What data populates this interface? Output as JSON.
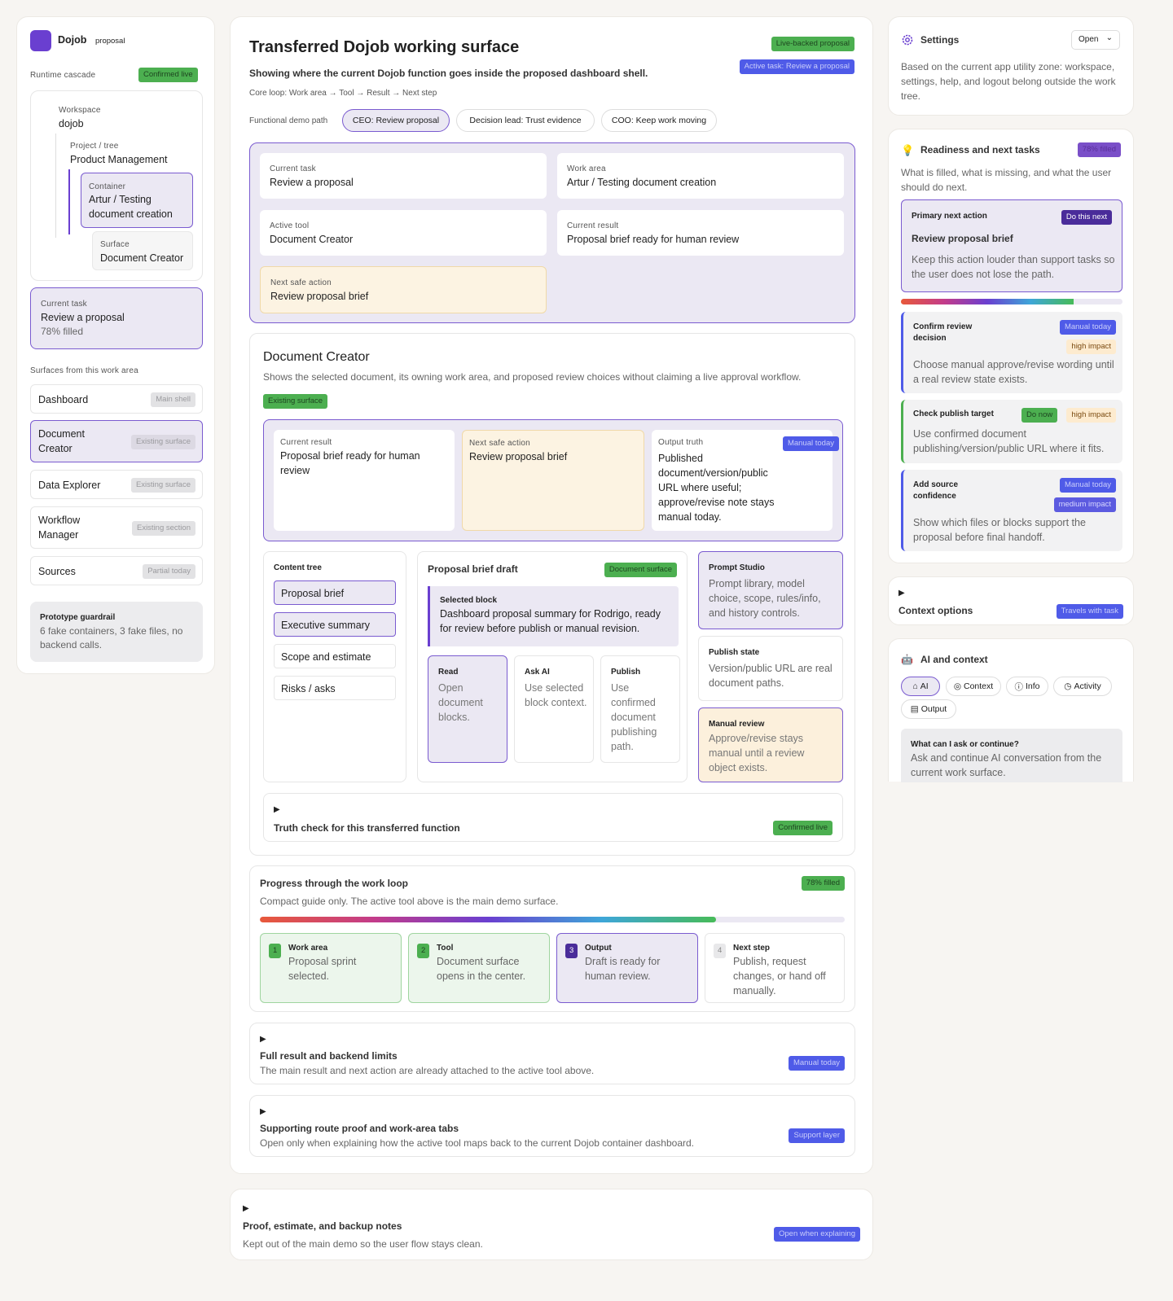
{
  "app": {
    "name": "Dojob",
    "tag": "proposal"
  },
  "left": {
    "cascade_label": "Runtime cascade",
    "cascade_badge": "Confirmed live",
    "workspace_label": "Workspace",
    "workspace_value": "dojob",
    "project_label": "Project / tree",
    "project_value": "Product Management",
    "container_label": "Container",
    "container_value": "Artur / Testing document creation",
    "surface_label": "Surface",
    "surface_value": "Document Creator",
    "task_label": "Current task",
    "task_value": "Review a proposal",
    "task_fill": "78% filled",
    "surfaces_heading": "Surfaces from this work area",
    "surfaces": [
      {
        "name": "Dashboard",
        "badge": "Main shell"
      },
      {
        "name": "Document Creator",
        "badge": "Existing surface"
      },
      {
        "name": "Data Explorer",
        "badge": "Existing surface"
      },
      {
        "name": "Workflow Manager",
        "badge": "Existing section"
      },
      {
        "name": "Sources",
        "badge": "Partial today"
      }
    ],
    "guardrail_title": "Prototype guardrail",
    "guardrail_text": "6 fake containers, 3 fake files, no backend calls."
  },
  "main": {
    "title": "Transferred Dojob working surface",
    "badge_live": "Live-backed proposal",
    "badge_task": "Active task: Review a proposal",
    "subtitle": "Showing where the current Dojob function goes inside the proposed dashboard shell.",
    "core_loop": "Core loop: Work area → Tool → Result → Next step",
    "demo_path_label": "Functional demo path",
    "demo_paths": [
      "CEO: Review proposal",
      "Decision lead: Trust evidence",
      "COO: Keep work moving"
    ],
    "summary": {
      "task_label": "Current task",
      "task_value": "Review a proposal",
      "area_label": "Work area",
      "area_value": "Artur / Testing document creation",
      "tool_label": "Active tool",
      "tool_value": "Document Creator",
      "result_label": "Current result",
      "result_value": "Proposal brief ready for human review",
      "next_label": "Next safe action",
      "next_value": "Review proposal brief"
    },
    "doc": {
      "title": "Document Creator",
      "desc": "Shows the selected document, its owning work area, and proposed review choices without claiming a live approval workflow.",
      "badge": "Existing surface",
      "result_label": "Current result",
      "result_value": "Proposal brief ready for human review",
      "next_label": "Next safe action",
      "next_value": "Review proposal brief",
      "truth_label": "Output truth",
      "truth_badge": "Manual today",
      "truth_value": "Published document/version/public URL where useful; approve/revise note stays manual today.",
      "tree_label": "Content tree",
      "tree": [
        "Proposal brief",
        "Executive summary",
        "Scope and estimate",
        "Risks / asks"
      ],
      "draft_title": "Proposal brief draft",
      "draft_badge": "Document surface",
      "block_label": "Selected block",
      "block_value": "Dashboard proposal summary for Rodrigo, ready for review before publish or manual revision.",
      "actions": [
        {
          "title": "Read",
          "text": "Open document blocks."
        },
        {
          "title": "Ask AI",
          "text": "Use selected block context."
        },
        {
          "title": "Publish",
          "text": "Use confirmed document publishing path."
        }
      ],
      "prompt_title": "Prompt Studio",
      "prompt_text": "Prompt library, model choice, scope, rules/info, and history controls.",
      "publish_title": "Publish state",
      "publish_text": "Version/public URL are real document paths.",
      "review_title": "Manual review",
      "review_text": "Approve/revise stays manual until a review object exists.",
      "truth_check": "Truth check for this transferred function",
      "truth_check_badge": "Confirmed live"
    },
    "progress": {
      "title": "Progress through the work loop",
      "badge": "78% filled",
      "desc": "Compact guide only. The active tool above is the main demo surface.",
      "value": 0.78,
      "steps": [
        {
          "num": "1",
          "title": "Work area",
          "text": "Proposal sprint selected."
        },
        {
          "num": "2",
          "title": "Tool",
          "text": "Document surface opens in the center."
        },
        {
          "num": "3",
          "title": "Output",
          "text": "Draft is ready for human review."
        },
        {
          "num": "4",
          "title": "Next step",
          "text": "Publish, request changes, or hand off manually."
        }
      ]
    },
    "full": {
      "title": "Full result and backend limits",
      "desc": "The main result and next action are already attached to the active tool above.",
      "badge": "Manual today"
    },
    "route": {
      "title": "Supporting route proof and work-area tabs",
      "desc": "Open only when explaining how the active tool maps back to the current Dojob container dashboard.",
      "badge": "Support layer"
    },
    "proof": {
      "title": "Proof, estimate, and backup notes",
      "desc": "Kept out of the main demo so the user flow stays clean.",
      "badge": "Open when explaining"
    }
  },
  "right": {
    "settings_title": "Settings",
    "settings_select": "Open",
    "settings_text": "Based on the current app utility zone: workspace, settings, help, and logout belong outside the work tree.",
    "ready_title": "Readiness and next tasks",
    "ready_badge": "78% filled",
    "ready_text": "What is filled, what is missing, and what the user should do next.",
    "primary_label": "Primary next action",
    "primary_badge": "Do this next",
    "primary_title": "Review proposal brief",
    "primary_text": "Keep this action louder than support tasks so the user does not lose the path.",
    "ready_value": 0.78,
    "tasks": [
      {
        "title": "Confirm review decision",
        "badge1": "Manual today",
        "badge2": "high impact",
        "text": "Choose manual approve/revise wording until a real review state exists."
      },
      {
        "title": "Check publish target",
        "badge1": "Do now",
        "badge2": "high impact",
        "text": "Use confirmed document publishing/version/public URL where it fits."
      },
      {
        "title": "Add source confidence",
        "badge1": "Manual today",
        "badge2": "medium impact",
        "text": "Show which files or blocks support the proposal before final handoff."
      }
    ],
    "context_title": "Context options",
    "context_badge": "Travels with task",
    "ai_title": "AI and context",
    "ai_tabs": [
      "AI",
      "Context",
      "Info",
      "Activity",
      "Output"
    ],
    "ai_q": "What can I ask or continue?",
    "ai_text": "Ask and continue AI conversation from the current work surface."
  },
  "colors": {
    "accent": "#6a3fd0",
    "green": "#4caf50",
    "blue": "#4f5be8"
  }
}
